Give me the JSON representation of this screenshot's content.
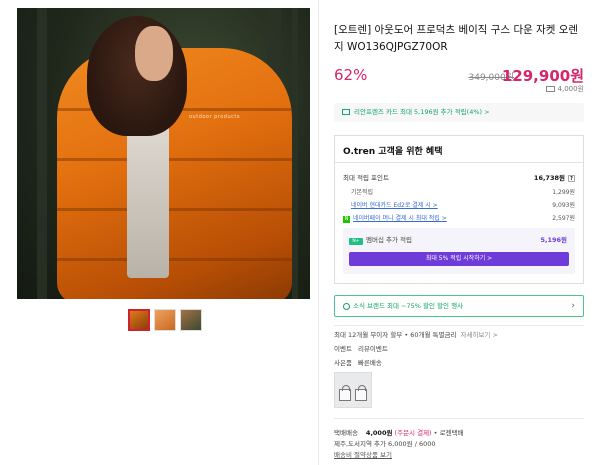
{
  "product": {
    "title": "[오트렌] 아웃도어 프로덕츠 베이직 구스 다운 자켓 오렌지 WO136QJPGZ70OR",
    "discount": "62%",
    "original_price": "349,000원",
    "sale_price": "129,900원",
    "points": "4,000원",
    "image_mark": "outdoor products"
  },
  "thumbnails": [
    "thumb-1",
    "thumb-2",
    "thumb-3"
  ],
  "card_promo": "리안프렌즈 카드 최대 5,196원 추가 적립(4%) >",
  "benefit": {
    "title": "O.tren 고객을 위한 혜택",
    "max_points_label": "최대 적립 포인트",
    "max_points_value": "16,738원",
    "help": "?",
    "rows": [
      {
        "label": "기본적립",
        "value": "1,299원"
      },
      {
        "label": "네이버 현대카드 Ed2로 결제 시 >",
        "value": "9,093원"
      },
      {
        "label": "네이버페이 머니 결제 시 최대 적립 >",
        "value": "2,597원"
      }
    ],
    "membership_badge": "N+",
    "membership_label": "멤버십 추가 적립",
    "membership_value": "5,196원",
    "membership_button": "최대 5% 적립 시작하기 >"
  },
  "news_banner": "소식 브랜드 최대 ~75% 할인 할인 행사",
  "installment": {
    "text": "최대 12개월 무이자 할부 • 60개월 특별금리",
    "link": "자세히보기 >"
  },
  "event": {
    "label": "이벤트",
    "value": "리뷰이벤트"
  },
  "gift": {
    "label": "사은품",
    "value": "빠른배송"
  },
  "shipping": {
    "label": "택배배송",
    "fee": "4,000원",
    "condition": "(주문시 결제)",
    "carrier": "• 로젠택배",
    "extra": "제주,도서지역 추가 6,000원 / 6000",
    "guide": "배송비 절약상품 보기"
  }
}
